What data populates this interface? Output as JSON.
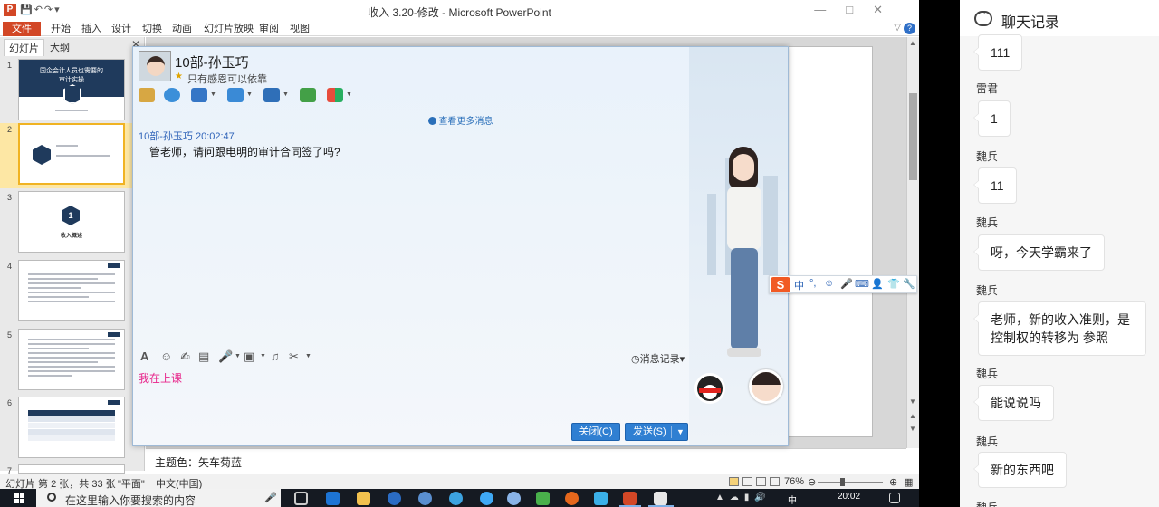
{
  "ppt": {
    "title": "收入 3.20-修改 - Microsoft PowerPoint",
    "app_icon": "P",
    "ribbon_tabs": [
      "文件",
      "开始",
      "插入",
      "设计",
      "切换",
      "动画",
      "幻灯片放映",
      "审阅",
      "视图"
    ],
    "left_tabs": [
      "幻灯片",
      "大纲"
    ],
    "slides": [
      {
        "num": "1",
        "title": "国企会计人员也需要的\n审计实操"
      },
      {
        "num": "2"
      },
      {
        "num": "3",
        "badge": "1",
        "caption": "收入概述"
      },
      {
        "num": "4"
      },
      {
        "num": "5"
      },
      {
        "num": "6"
      },
      {
        "num": "7"
      }
    ],
    "notes": "主题色：矢车菊蓝",
    "status": {
      "slide_info": "幻灯片 第 2 张，共 33 张",
      "theme": "\"平面\"",
      "language": "中文(中国)",
      "zoom": "76%"
    }
  },
  "chat": {
    "contact_name": "10部-孙玉巧",
    "signature": "只有感恩可以依靠",
    "view_more": "查看更多消息",
    "message": {
      "header": "10部-孙玉巧  20:02:47",
      "text": "管老师，请问跟电明的审计合同签了吗?"
    },
    "message_record": "消息记录",
    "input_text": "我在上课",
    "close_button": "关闭(C)",
    "send_button": "发送(S)"
  },
  "ime": {
    "logo": "S",
    "items": [
      "中",
      "°,",
      "☺",
      "🎤",
      "⌨",
      "👤",
      "👕",
      "🔧"
    ]
  },
  "taskbar": {
    "search_placeholder": "在这里输入你要搜索的内容",
    "time": "20:02",
    "ime_label": "中"
  },
  "chatpanel": {
    "title": "聊天记录",
    "messages": [
      {
        "sender": "",
        "text": "111"
      },
      {
        "sender": "雷君",
        "text": "1"
      },
      {
        "sender": "魏兵",
        "text": "11"
      },
      {
        "sender": "魏兵",
        "text": "呀，今天学霸来了"
      },
      {
        "sender": "魏兵",
        "text": "老师，新的收入准则，是控制权的转移为 参照"
      },
      {
        "sender": "魏兵",
        "text": "能说说吗"
      },
      {
        "sender": "魏兵",
        "text": "新的东西吧"
      },
      {
        "sender": "魏兵",
        "text": ""
      }
    ]
  },
  "colors": {
    "ppt_accent": "#d24726",
    "slide_navy": "#1f3a5c",
    "chat_button": "#2f7fd2",
    "input_text": "#e8268b",
    "thumbnail_selected": "#f0b323"
  }
}
